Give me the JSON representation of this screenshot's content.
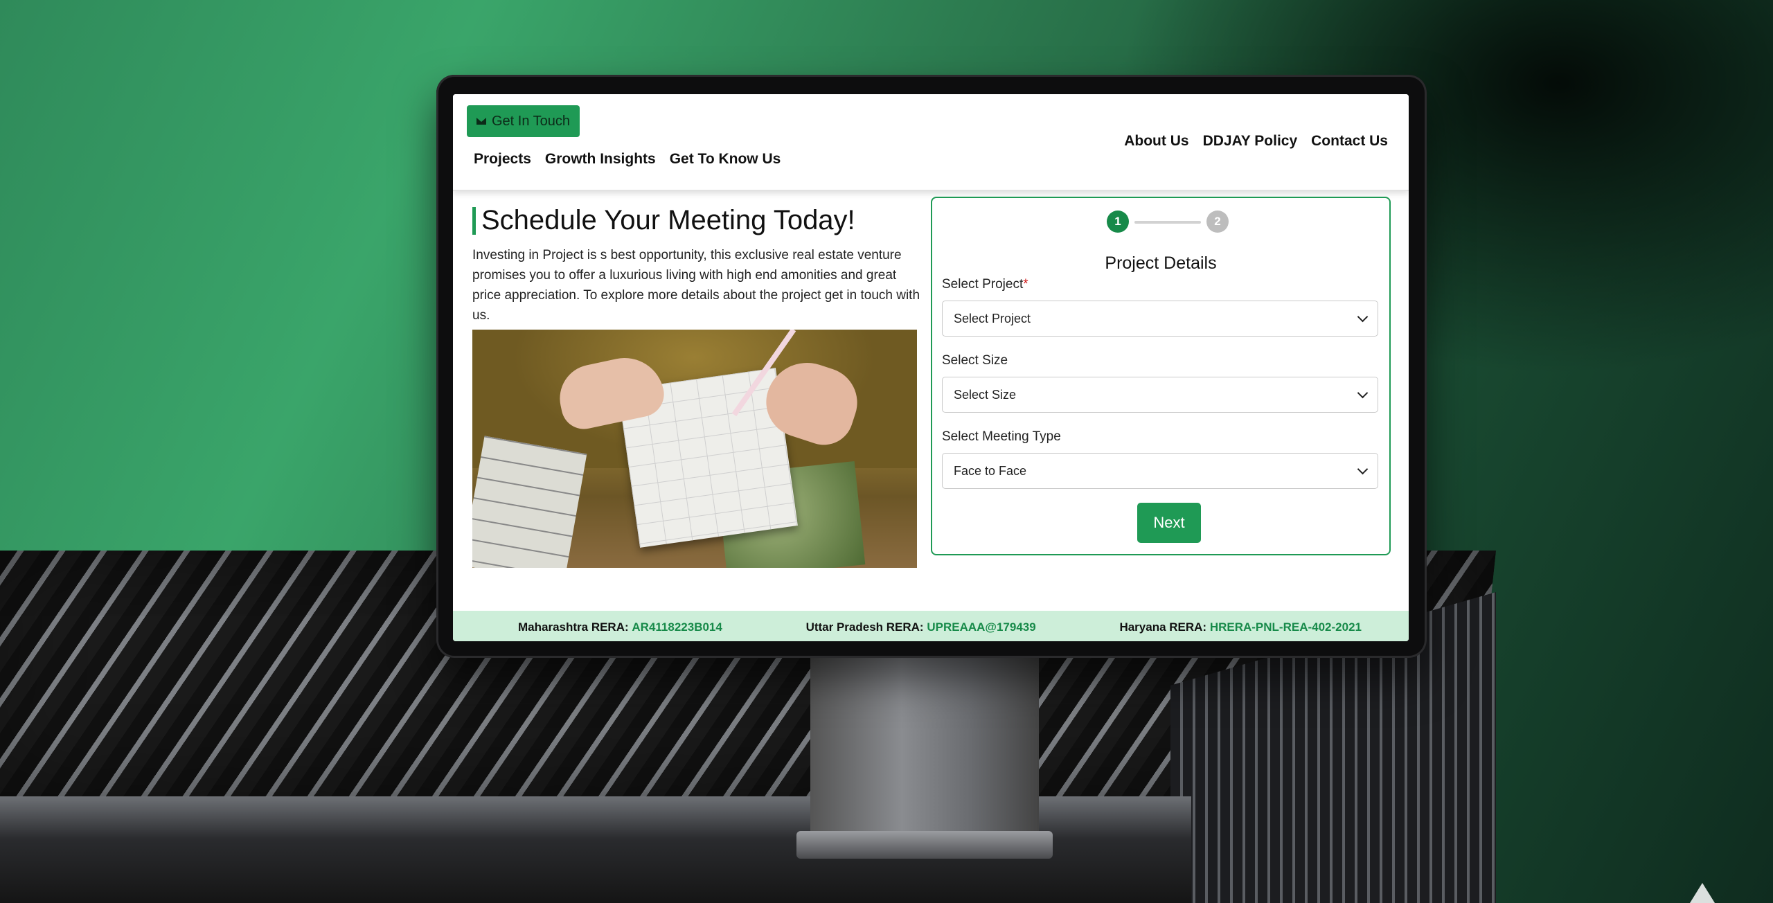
{
  "header": {
    "cta_label": "Get In Touch",
    "nav_left": [
      "Projects",
      "Growth Insights",
      "Get To Know Us"
    ],
    "nav_right": [
      "About Us",
      "DDJAY Policy",
      "Contact Us"
    ]
  },
  "hero": {
    "title": "Schedule Your Meeting Today!",
    "intro": "Investing in Project is s best opportunity, this exclusive real estate venture promises you to offer a luxurious living with high end amonities and great price appreciation. To explore more details about the project get in touch with us."
  },
  "form": {
    "steps": [
      "1",
      "2"
    ],
    "active_step": 1,
    "title": "Project Details",
    "fields": [
      {
        "label": "Select Project",
        "required": "*",
        "value": "Select Project"
      },
      {
        "label": "Select Size",
        "value": "Select Size"
      },
      {
        "label": "Select Meeting Type",
        "value": "Face to Face"
      }
    ],
    "next_label": "Next"
  },
  "footer": {
    "rera": [
      {
        "label": "Maharashtra RERA:",
        "code": "AR4118223B014"
      },
      {
        "label": "Uttar Pradesh RERA:",
        "code": "UPREAAA@179439"
      },
      {
        "label": "Haryana RERA:",
        "code": "HRERA-PNL-REA-402-2021"
      }
    ]
  },
  "colors": {
    "accent": "#1f9a55",
    "footer_bg": "#cdeed9",
    "step_inactive": "#bdbdbd"
  },
  "icons": {
    "cta": "mail-icon",
    "select": "chevron-down-icon"
  }
}
